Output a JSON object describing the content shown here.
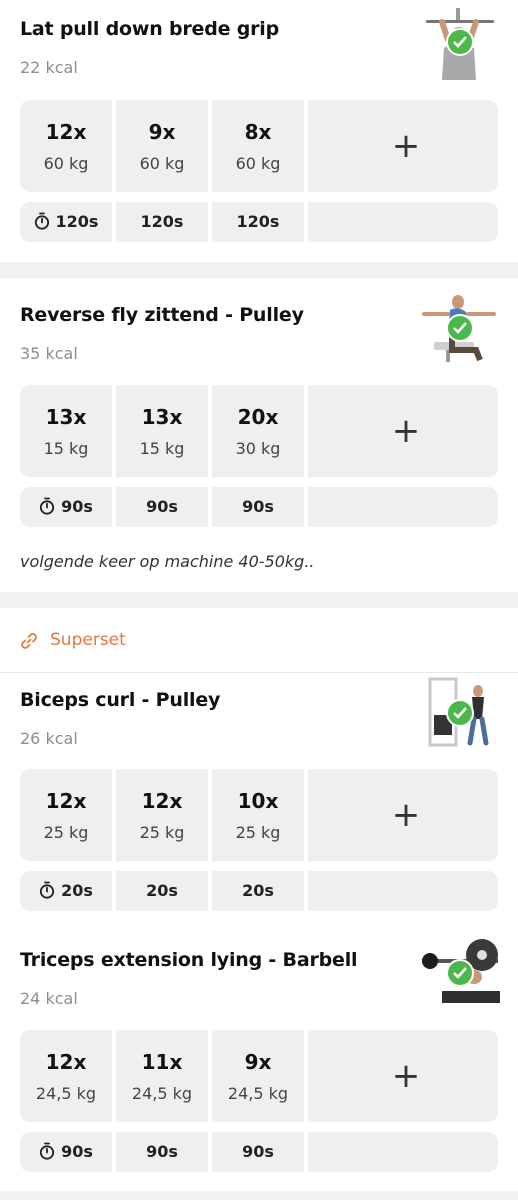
{
  "exercises": [
    {
      "name": "Lat pull down brede grip",
      "kcal": "22 kcal",
      "sets": [
        {
          "reps": "12x",
          "weight": "60 kg"
        },
        {
          "reps": "9x",
          "weight": "60 kg"
        },
        {
          "reps": "8x",
          "weight": "60 kg"
        }
      ],
      "rests": [
        "120s",
        "120s",
        "120s"
      ],
      "add_label": "+"
    },
    {
      "name": "Reverse fly zittend - Pulley",
      "kcal": "35 kcal",
      "sets": [
        {
          "reps": "13x",
          "weight": "15 kg"
        },
        {
          "reps": "13x",
          "weight": "15 kg"
        },
        {
          "reps": "20x",
          "weight": "30 kg"
        }
      ],
      "rests": [
        "90s",
        "90s",
        "90s"
      ],
      "note": "volgende keer op machine 40-50kg..",
      "add_label": "+"
    },
    {
      "name": "Biceps curl - Pulley",
      "kcal": "26 kcal",
      "sets": [
        {
          "reps": "12x",
          "weight": "25 kg"
        },
        {
          "reps": "12x",
          "weight": "25 kg"
        },
        {
          "reps": "10x",
          "weight": "25 kg"
        }
      ],
      "rests": [
        "20s",
        "20s",
        "20s"
      ],
      "add_label": "+"
    },
    {
      "name": "Triceps extension lying - Barbell",
      "kcal": "24 kcal",
      "sets": [
        {
          "reps": "12x",
          "weight": "24,5 kg"
        },
        {
          "reps": "11x",
          "weight": "24,5 kg"
        },
        {
          "reps": "9x",
          "weight": "24,5 kg"
        }
      ],
      "rests": [
        "90s",
        "90s",
        "90s"
      ],
      "add_label": "+"
    }
  ],
  "superset": {
    "label": "Superset"
  },
  "colors": {
    "accent": "#e8783a",
    "check": "#4cb84c",
    "cell": "#efefef"
  },
  "icons": {
    "timer": "stopwatch-icon",
    "link": "link-icon",
    "check": "check-icon",
    "add": "plus-icon"
  }
}
